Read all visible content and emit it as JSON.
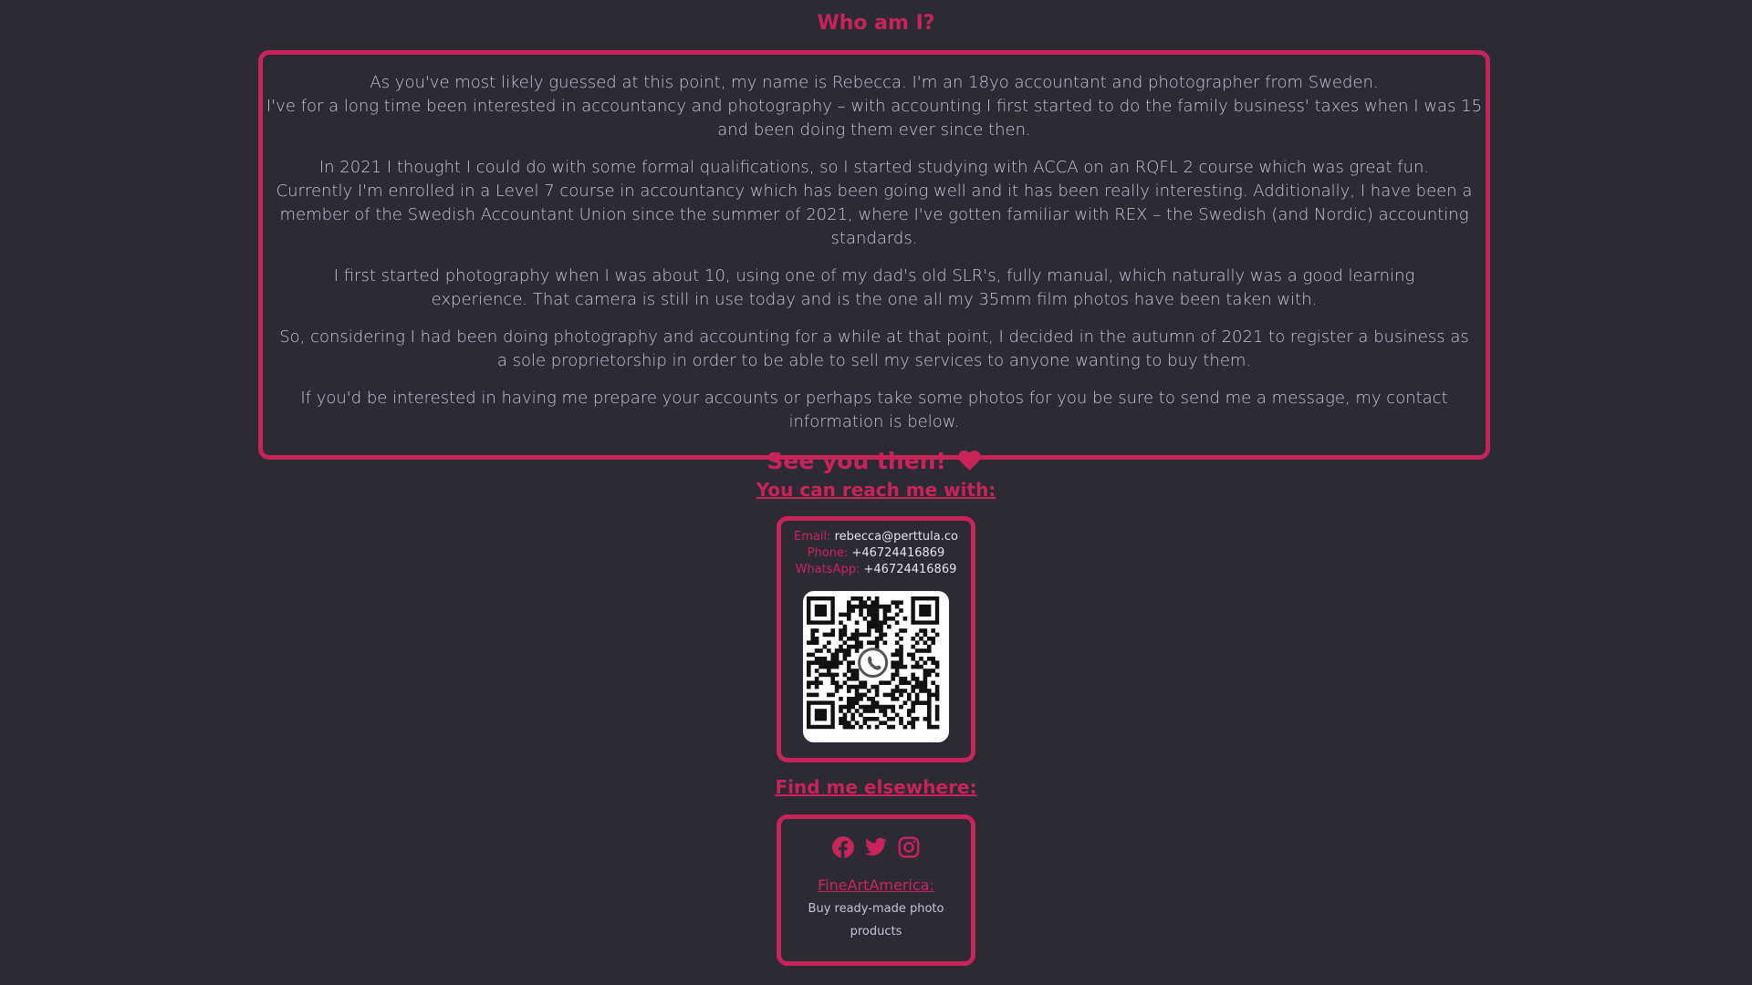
{
  "about": {
    "title": "Who am I?",
    "paragraphs": [
      "As you've most likely guessed at this point, my name is Rebecca. I'm an 18yo accountant and photographer from Sweden.\nI've for a long time been interested in accountancy and photography – with accounting I first started to do the family business' taxes when I was 15 and been doing them ever since then.",
      "In 2021 I thought I could do with some formal qualifications, so I started studying with ACCA on an RQFL 2 course which was great fun.\nCurrently I'm enrolled in a Level 7 course in accountancy which has been going well and it has been really interesting. Additionally, I have been a member of the Swedish Accountant Union since the summer of 2021, where I've gotten familiar with REX – the Swedish (and Nordic) accounting standards.",
      "I first started photography when I was about 10, using one of my dad's old SLR's, fully manual, which naturally was a good learning experience. That camera is still in use today and is the one all my 35mm film photos have been taken with.",
      "So, considering I had been doing photography and accounting for a while at that point, I decided in the autumn of 2021 to register a business as a sole proprietorship in order to be able to sell my services to anyone wanting to buy them.",
      "If you'd be interested in having me prepare your accounts or perhaps take some photos for you be sure to send me a message, my contact information is below."
    ],
    "closing": "See you then!"
  },
  "contact": {
    "title": "You can reach me with:",
    "email_label": "Email:",
    "email": "rebecca@perttula.co",
    "phone_label": "Phone:",
    "phone": "+46724416869",
    "whatsapp_label": "WhatsApp:",
    "whatsapp": "+46724416869"
  },
  "elsewhere": {
    "title": "Find me elsewhere:",
    "icons": [
      "facebook-icon",
      "twitter-icon",
      "instagram-icon"
    ],
    "fineart_link": "FineArtAmerica:",
    "fineart_desc": "Buy ready-made photo products"
  },
  "colors": {
    "background": "#2c2b33",
    "accent": "#c8245a",
    "text": "#c9c2d4"
  }
}
